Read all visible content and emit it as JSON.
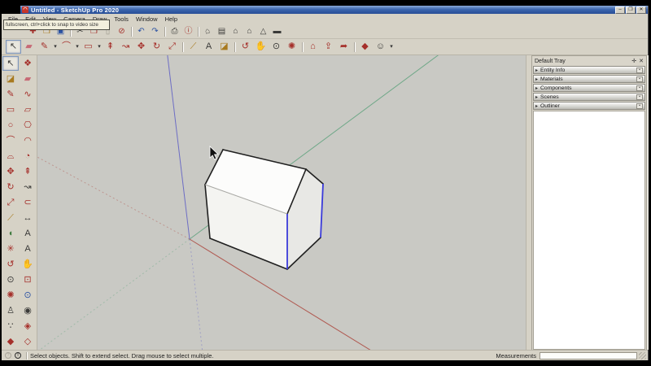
{
  "titlebar": {
    "title": "Untitled - SketchUp Pro 2020",
    "app_icon_glyph": "◠",
    "buttons": [
      {
        "name": "minimize-button",
        "glyph": "–"
      },
      {
        "name": "maximize-button",
        "glyph": "❐"
      },
      {
        "name": "close-button",
        "glyph": "✕"
      }
    ]
  },
  "tooltip": {
    "text": "fullscreen, ctrl+click to snap to video size"
  },
  "menubar": {
    "items": [
      {
        "name": "menu-file",
        "label": "File"
      },
      {
        "name": "menu-edit",
        "label": "Edit"
      },
      {
        "name": "menu-view",
        "label": "View"
      },
      {
        "name": "menu-camera",
        "label": "Camera"
      },
      {
        "name": "menu-draw",
        "label": "Draw"
      },
      {
        "name": "menu-tools",
        "label": "Tools"
      },
      {
        "name": "menu-window",
        "label": "Window"
      },
      {
        "name": "menu-help",
        "label": "Help"
      }
    ]
  },
  "toolbar_standard": {
    "items": [
      {
        "name": "new-button",
        "glyph": "✚",
        "cls": "red"
      },
      {
        "name": "open-button",
        "glyph": "❒",
        "cls": "yellow"
      },
      {
        "name": "save-button",
        "glyph": "▣",
        "cls": "blue"
      },
      {
        "name": "separator",
        "glyph": "",
        "cls": "sep",
        "inter": false
      },
      {
        "name": "cut-button",
        "glyph": "✂",
        "cls": "dark"
      },
      {
        "name": "copy-button",
        "glyph": "❐",
        "cls": "red"
      },
      {
        "name": "paste-button",
        "glyph": "▯",
        "cls": "muted"
      },
      {
        "name": "erase-button",
        "glyph": "⊘",
        "cls": "red"
      },
      {
        "name": "separator",
        "glyph": "",
        "cls": "sep",
        "inter": false
      },
      {
        "name": "undo-button",
        "glyph": "↶",
        "cls": "blue"
      },
      {
        "name": "redo-button",
        "glyph": "↷",
        "cls": "blue"
      },
      {
        "name": "separator",
        "glyph": "",
        "cls": "sep",
        "inter": false
      },
      {
        "name": "print-button",
        "glyph": "⎙",
        "cls": "dark"
      },
      {
        "name": "model-info-button",
        "glyph": "ⓘ",
        "cls": "red"
      },
      {
        "name": "separator",
        "glyph": "",
        "cls": "sep",
        "inter": false
      },
      {
        "name": "iso-view-button",
        "glyph": "⌂",
        "cls": "dark tilt"
      },
      {
        "name": "top-view-button",
        "glyph": "▤",
        "cls": "dark"
      },
      {
        "name": "front-view-button",
        "glyph": "⌂",
        "cls": "dark"
      },
      {
        "name": "right-view-button",
        "glyph": "⌂",
        "cls": "dark"
      },
      {
        "name": "left-view-button",
        "glyph": "△",
        "cls": "dark"
      },
      {
        "name": "back-view-button",
        "glyph": "▬",
        "cls": "dark"
      }
    ]
  },
  "toolbar_principal": {
    "items": [
      {
        "name": "select-tool-button",
        "glyph": "↖",
        "cls": "dark pressed"
      },
      {
        "name": "eraser-tool-button",
        "glyph": "▰",
        "cls": "pink"
      },
      {
        "name": "line-tool-button",
        "glyph": "✎",
        "cls": "red"
      },
      {
        "name": "line-tool-dropdown",
        "glyph": "▾",
        "cls": "dd"
      },
      {
        "name": "arc-tool-button",
        "glyph": "⌒",
        "cls": "red"
      },
      {
        "name": "arc-tool-dropdown",
        "glyph": "▾",
        "cls": "dd"
      },
      {
        "name": "shapes-tool-button",
        "glyph": "▭",
        "cls": "red"
      },
      {
        "name": "shapes-tool-dropdown",
        "glyph": "▾",
        "cls": "dd"
      },
      {
        "name": "push-pull-button",
        "glyph": "⇞",
        "cls": "red"
      },
      {
        "name": "follow-me-button",
        "glyph": "↝",
        "cls": "red"
      },
      {
        "name": "move-tool-button",
        "glyph": "✥",
        "cls": "red"
      },
      {
        "name": "rotate-tool-button",
        "glyph": "↻",
        "cls": "red"
      },
      {
        "name": "scale-tool-button",
        "glyph": "⤢",
        "cls": "red"
      },
      {
        "name": "separator",
        "glyph": "",
        "cls": "sep",
        "inter": false
      },
      {
        "name": "tape-measure-button",
        "glyph": "⟋",
        "cls": "yellow"
      },
      {
        "name": "text-tool-button",
        "glyph": "A",
        "cls": "dark"
      },
      {
        "name": "paint-bucket-button",
        "glyph": "◪",
        "cls": "yellow"
      },
      {
        "name": "separator",
        "glyph": "",
        "cls": "sep",
        "inter": false
      },
      {
        "name": "orbit-tool-button",
        "glyph": "↺",
        "cls": "red"
      },
      {
        "name": "pan-tool-button",
        "glyph": "✋",
        "cls": "dark"
      },
      {
        "name": "zoom-tool-button",
        "glyph": "⊙",
        "cls": "dark"
      },
      {
        "name": "zoom-extents-button",
        "glyph": "✺",
        "cls": "red"
      },
      {
        "name": "separator",
        "glyph": "",
        "cls": "sep",
        "inter": false
      },
      {
        "name": "3d-warehouse-button",
        "glyph": "⌂",
        "cls": "red"
      },
      {
        "name": "share-model-button",
        "glyph": "⇪",
        "cls": "red"
      },
      {
        "name": "send-to-layout-button",
        "glyph": "➦",
        "cls": "red"
      },
      {
        "name": "separator",
        "glyph": "",
        "cls": "sep",
        "inter": false
      },
      {
        "name": "extension-warehouse-button",
        "glyph": "◆",
        "cls": "red"
      },
      {
        "name": "sign-in-button",
        "glyph": "☺",
        "cls": "dark"
      },
      {
        "name": "sign-in-dropdown",
        "glyph": "▾",
        "cls": "dd"
      }
    ]
  },
  "large_tool_set": {
    "items": [
      {
        "name": "lts-select-tool",
        "glyph": "↖",
        "cls": "dark pressed"
      },
      {
        "name": "lts-make-component",
        "glyph": "❖",
        "cls": "red"
      },
      {
        "name": "lts-paint-bucket",
        "glyph": "◪",
        "cls": "yellow"
      },
      {
        "name": "lts-eraser-tool",
        "glyph": "▰",
        "cls": "pink"
      },
      {
        "name": "lts-line-tool",
        "glyph": "✎",
        "cls": "red"
      },
      {
        "name": "lts-freehand-tool",
        "glyph": "∿",
        "cls": "red"
      },
      {
        "name": "lts-rectangle-tool",
        "glyph": "▭",
        "cls": "red"
      },
      {
        "name": "lts-rotated-rectangle-tool",
        "glyph": "▱",
        "cls": "red"
      },
      {
        "name": "lts-circle-tool",
        "glyph": "○",
        "cls": "red"
      },
      {
        "name": "lts-polygon-tool",
        "glyph": "⎔",
        "cls": "red"
      },
      {
        "name": "lts-arc-tool",
        "glyph": "⌒",
        "cls": "red"
      },
      {
        "name": "lts-two-point-arc-tool",
        "glyph": "◠",
        "cls": "red"
      },
      {
        "name": "lts-three-point-arc-tool",
        "glyph": "⌓",
        "cls": "red"
      },
      {
        "name": "lts-pie-tool",
        "glyph": "◔",
        "cls": "red"
      },
      {
        "name": "lts-move-tool",
        "glyph": "✥",
        "cls": "red"
      },
      {
        "name": "lts-push-pull-tool",
        "glyph": "⇞",
        "cls": "red"
      },
      {
        "name": "lts-rotate-tool",
        "glyph": "↻",
        "cls": "red"
      },
      {
        "name": "lts-follow-me-tool",
        "glyph": "↝",
        "cls": "dark"
      },
      {
        "name": "lts-scale-tool",
        "glyph": "⤢",
        "cls": "red"
      },
      {
        "name": "lts-offset-tool",
        "glyph": "⊂",
        "cls": "red"
      },
      {
        "name": "lts-tape-measure-tool",
        "glyph": "⟋",
        "cls": "yellow"
      },
      {
        "name": "lts-dimension-tool",
        "glyph": "↔",
        "cls": "dark"
      },
      {
        "name": "lts-protractor-tool",
        "glyph": "◖",
        "cls": "green"
      },
      {
        "name": "lts-text-tool",
        "glyph": "A",
        "cls": "dark"
      },
      {
        "name": "lts-axes-tool",
        "glyph": "✳",
        "cls": "red"
      },
      {
        "name": "lts-3d-text-tool",
        "glyph": "A",
        "cls": "dark"
      },
      {
        "name": "lts-orbit-tool",
        "glyph": "↺",
        "cls": "red"
      },
      {
        "name": "lts-pan-tool",
        "glyph": "✋",
        "cls": "dark"
      },
      {
        "name": "lts-zoom-tool",
        "glyph": "⊙",
        "cls": "dark"
      },
      {
        "name": "lts-zoom-window-tool",
        "glyph": "⊡",
        "cls": "red"
      },
      {
        "name": "lts-zoom-extents-tool",
        "glyph": "✺",
        "cls": "red"
      },
      {
        "name": "lts-zoom-previous-tool",
        "glyph": "⊙",
        "cls": "blue"
      },
      {
        "name": "lts-position-camera-tool",
        "glyph": "♙",
        "cls": "dark"
      },
      {
        "name": "lts-look-around-tool",
        "glyph": "◉",
        "cls": "dark"
      },
      {
        "name": "lts-walk-tool",
        "glyph": "∵",
        "cls": "dark"
      },
      {
        "name": "lts-section-plane-tool",
        "glyph": "◈",
        "cls": "red"
      },
      {
        "name": "lts-section-fill-tool",
        "glyph": "◆",
        "cls": "red"
      },
      {
        "name": "lts-section-display-tool",
        "glyph": "◇",
        "cls": "red"
      }
    ]
  },
  "viewport": {
    "background": "#c9c9c4",
    "axis_colors": {
      "red": "#b05a52",
      "green": "#6fa888",
      "blue": "#6d6dc4"
    },
    "edge_color": "#202020",
    "soft_edge_color": "#a8a8a4",
    "selected_edge_color": "#3a3ada",
    "faces": {
      "roof": "#fcfcfb",
      "front": "#f4f4f1",
      "side": "#e8e8e5"
    }
  },
  "tray": {
    "title": "Default Tray",
    "pin_icon": "✛",
    "close_icon": "✕",
    "section_arrow": "▸",
    "section_button": "▪",
    "sections": [
      {
        "name": "tray-section-entity-info",
        "label": "Entity Info"
      },
      {
        "name": "tray-section-materials",
        "label": "Materials"
      },
      {
        "name": "tray-section-components",
        "label": "Components"
      },
      {
        "name": "tray-section-scenes",
        "label": "Scenes"
      },
      {
        "name": "tray-section-outliner",
        "label": "Outliner"
      }
    ]
  },
  "statusbar": {
    "geolocation_glyph": "?",
    "credit_glyph": "!",
    "hint": "Select objects. Shift to extend select. Drag mouse to select multiple.",
    "measurements_label": "Measurements",
    "measurements_value": ""
  }
}
